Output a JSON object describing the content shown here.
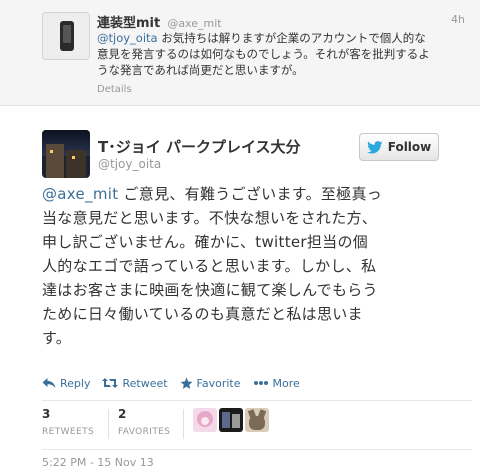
{
  "parent_tweet": {
    "name": "連装型mit",
    "handle": "@axe_mit",
    "time": "4h",
    "mention": "@tjoy_oita",
    "text_line1": " お気持ちは解りますが企業のアカウントで個人的な",
    "text_line2": "意見を発言するのは如何なものでしょう。それが客を批判するよ",
    "text_line3": "うな発言であれば尚更だと思いますが。",
    "details_label": "Details"
  },
  "main_tweet": {
    "name": "T･ジョイ パークプレイス大分",
    "handle": "@tjoy_oita",
    "follow_label": "Follow",
    "mention": "@axe_mit",
    "text_line1": " ご意見、有難うございます。至極真っ",
    "text_line2": "当な意見だと思います。不快な想いをされた方、",
    "text_line3": "申し訳ございません。確かに、twitter担当の個",
    "text_line4": "人的なエゴで語っていると思います。しかし、私",
    "text_line5": "達はお客さまに映画を快適に観て楽しんでもらう",
    "text_line6": "ために日々働いているのも真意だと私は思いま",
    "text_line7": "す。",
    "timestamp": "5:22 PM - 15 Nov 13"
  },
  "actions": {
    "reply": "Reply",
    "retweet": "Retweet",
    "favorite": "Favorite",
    "more": "More"
  },
  "stats": {
    "retweets_count": "3",
    "retweets_label": "RETWEETS",
    "favorites_count": "2",
    "favorites_label": "FAVORITES"
  },
  "colors": {
    "link": "#3a6f9a",
    "twitter_blue": "#2aa9e0",
    "muted": "#999999"
  }
}
